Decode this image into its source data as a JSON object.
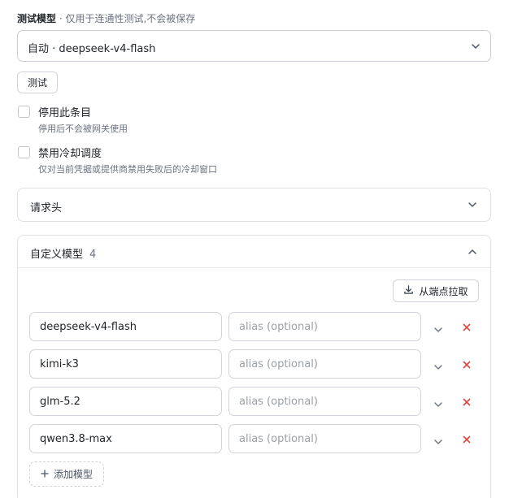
{
  "test_model": {
    "label": "测试模型",
    "hint": " · 仅用于连通性测试,不会被保存",
    "selected": "自动 · deepseek-v4-flash",
    "test_button": "测试"
  },
  "options": [
    {
      "title": "停用此条目",
      "desc": "停用后不会被网关使用",
      "checked": false
    },
    {
      "title": "禁用冷却调度",
      "desc": "仅对当前凭据或提供商禁用失败后的冷却窗口",
      "checked": false
    }
  ],
  "headers_panel": {
    "title": "请求头",
    "expanded": false
  },
  "models_panel": {
    "title": "自定义模型",
    "count": "4",
    "expanded": true,
    "fetch_button": "从端点拉取",
    "add_button": "添加模型",
    "alias_placeholder": "alias (optional)",
    "rows": [
      {
        "name": "deepseek-v4-flash",
        "alias": ""
      },
      {
        "name": "kimi-k3",
        "alias": ""
      },
      {
        "name": "glm-5.2",
        "alias": ""
      },
      {
        "name": "qwen3.8-max",
        "alias": ""
      }
    ]
  },
  "colors": {
    "danger": "#e0443a",
    "border": "#d0d4da",
    "muted": "#6b7280"
  },
  "icons": {
    "chevron": "chevron-down-icon",
    "remove": "close-icon",
    "download": "download-icon",
    "add": "plus-icon"
  }
}
